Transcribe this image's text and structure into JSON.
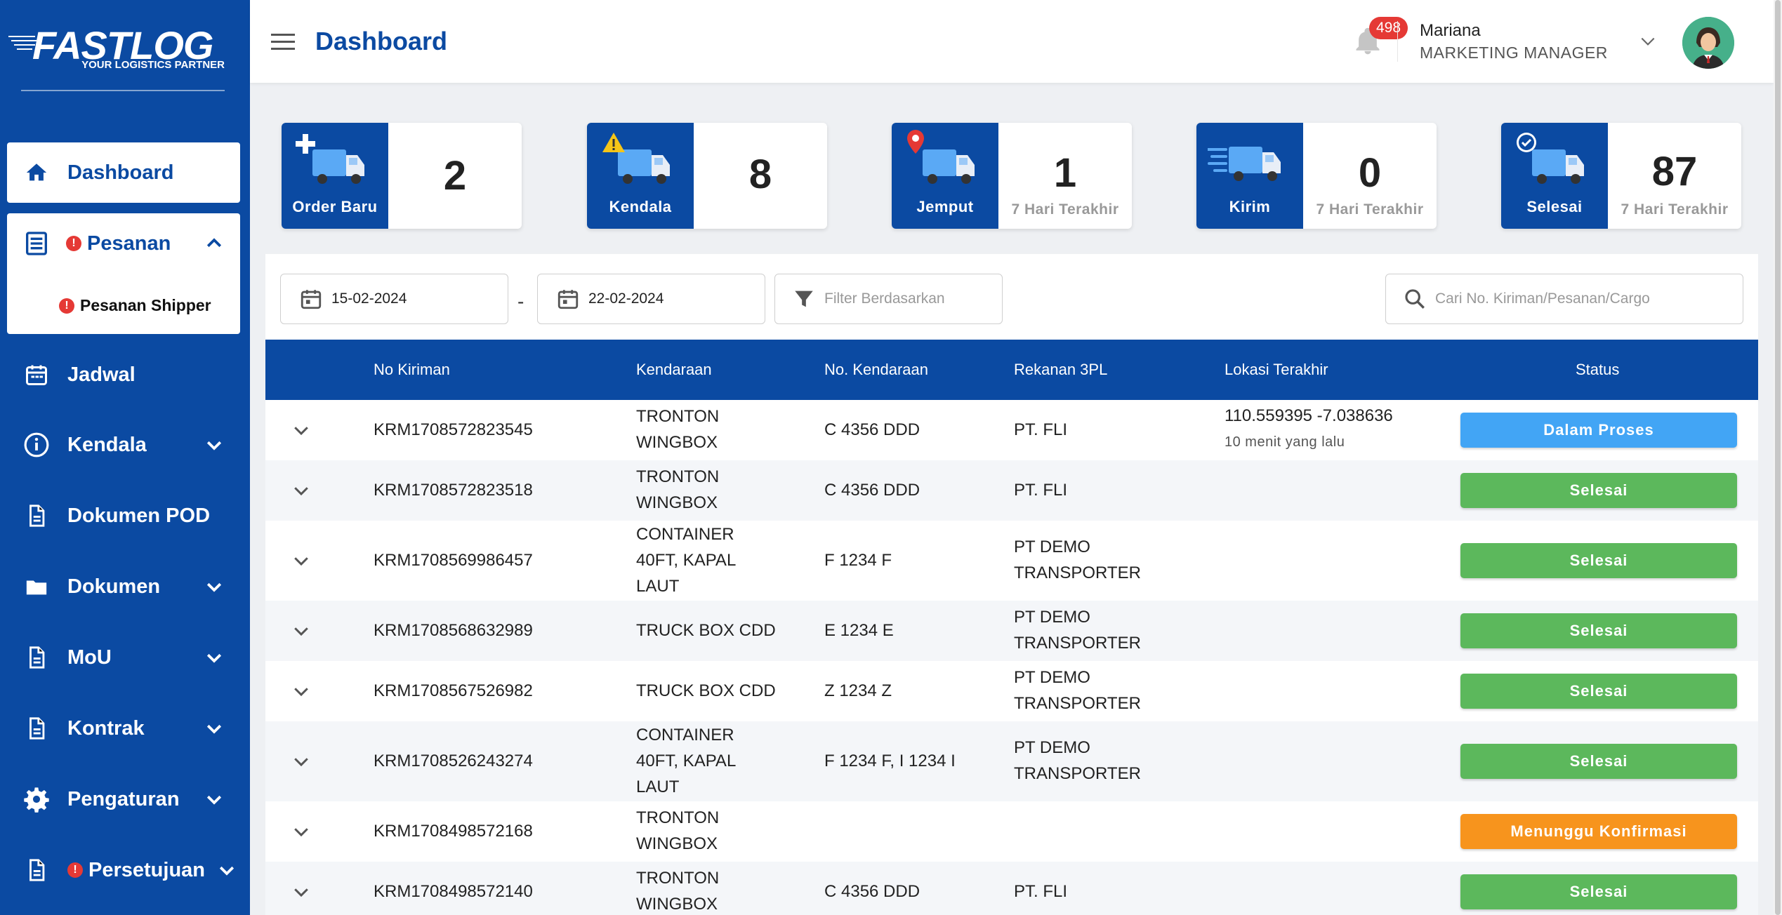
{
  "brand": {
    "name": "FASTLOG",
    "tagline": "YOUR LOGISTICS PARTNER"
  },
  "sidebar": {
    "items": [
      {
        "label": "Dashboard",
        "icon": "home-icon",
        "active": true
      },
      {
        "label": "Pesanan",
        "icon": "list-icon",
        "expanded": true,
        "alert": "!",
        "children": [
          {
            "label": "Pesanan Shipper",
            "alert": "!"
          }
        ]
      },
      {
        "label": "Jadwal",
        "icon": "calendar-icon"
      },
      {
        "label": "Kendala",
        "icon": "info-icon"
      },
      {
        "label": "Dokumen POD",
        "icon": "document-icon"
      },
      {
        "label": "Dokumen",
        "icon": "folder-icon"
      },
      {
        "label": "MoU",
        "icon": "document-icon"
      },
      {
        "label": "Kontrak",
        "icon": "document-icon"
      },
      {
        "label": "Pengaturan",
        "icon": "gear-icon"
      },
      {
        "label": "Persetujuan",
        "icon": "document-icon",
        "alert": "!"
      }
    ]
  },
  "header": {
    "title": "Dashboard",
    "notification_count": "498",
    "user_name": "Mariana",
    "user_role": "MARKETING MANAGER"
  },
  "stats": [
    {
      "label": "Order Baru",
      "value": "2",
      "note": "",
      "icon": "truck-plus-icon"
    },
    {
      "label": "Kendala",
      "value": "8",
      "note": "",
      "icon": "truck-warning-icon"
    },
    {
      "label": "Jemput",
      "value": "1",
      "note": "7 Hari Terakhir",
      "icon": "truck-pin-icon"
    },
    {
      "label": "Kirim",
      "value": "0",
      "note": "7 Hari Terakhir",
      "icon": "truck-fast-icon"
    },
    {
      "label": "Selesai",
      "value": "87",
      "note": "7 Hari Terakhir",
      "icon": "truck-check-icon"
    }
  ],
  "filters": {
    "date_from": "15-02-2024",
    "date_separator": "-",
    "date_to": "22-02-2024",
    "filter_placeholder": "Filter Berdasarkan",
    "search_placeholder": "Cari No. Kiriman/Pesanan/Cargo"
  },
  "table": {
    "columns": [
      "No Kiriman",
      "Kendaraan",
      "No. Kendaraan",
      "Rekanan 3PL",
      "Lokasi Terakhir",
      "Status"
    ],
    "rows": [
      {
        "no": "KRM1708572823545",
        "kendaraan": [
          "TRONTON",
          "WINGBOX"
        ],
        "nopol": "C 4356 DDD",
        "rekanan": [
          "PT. FLI"
        ],
        "lokasi": "110.559395 -7.038636",
        "lokasi_time": "10 menit yang lalu",
        "status": "Dalam Proses",
        "status_color": "#42a5f5"
      },
      {
        "no": "KRM1708572823518",
        "kendaraan": [
          "TRONTON",
          "WINGBOX"
        ],
        "nopol": "C 4356 DDD",
        "rekanan": [
          "PT. FLI"
        ],
        "lokasi": "",
        "lokasi_time": "",
        "status": "Selesai",
        "status_color": "#5cb85c"
      },
      {
        "no": "KRM1708569986457",
        "kendaraan": [
          "CONTAINER",
          "40FT, KAPAL",
          "LAUT"
        ],
        "nopol": "F 1234 F",
        "rekanan": [
          "PT DEMO",
          "TRANSPORTER"
        ],
        "lokasi": "",
        "lokasi_time": "",
        "status": "Selesai",
        "status_color": "#5cb85c"
      },
      {
        "no": "KRM1708568632989",
        "kendaraan": [
          "TRUCK BOX CDD"
        ],
        "nopol": "E 1234 E",
        "rekanan": [
          "PT DEMO",
          "TRANSPORTER"
        ],
        "lokasi": "",
        "lokasi_time": "",
        "status": "Selesai",
        "status_color": "#5cb85c"
      },
      {
        "no": "KRM1708567526982",
        "kendaraan": [
          "TRUCK BOX CDD"
        ],
        "nopol": "Z 1234 Z",
        "rekanan": [
          "PT DEMO",
          "TRANSPORTER"
        ],
        "lokasi": "",
        "lokasi_time": "",
        "status": "Selesai",
        "status_color": "#5cb85c"
      },
      {
        "no": "KRM1708526243274",
        "kendaraan": [
          "CONTAINER",
          "40FT, KAPAL",
          "LAUT"
        ],
        "nopol": "F 1234 F, I 1234 I",
        "rekanan": [
          "PT DEMO",
          "TRANSPORTER"
        ],
        "lokasi": "",
        "lokasi_time": "",
        "status": "Selesai",
        "status_color": "#5cb85c"
      },
      {
        "no": "KRM1708498572168",
        "kendaraan": [
          "TRONTON",
          "WINGBOX"
        ],
        "nopol": "",
        "rekanan": [],
        "lokasi": "",
        "lokasi_time": "",
        "status": "Menunggu Konfirmasi",
        "status_color": "#f7941d"
      },
      {
        "no": "KRM1708498572140",
        "kendaraan": [
          "TRONTON",
          "WINGBOX"
        ],
        "nopol": "C 4356 DDD",
        "rekanan": [
          "PT. FLI"
        ],
        "lokasi": "",
        "lokasi_time": "",
        "status": "Selesai",
        "status_color": "#5cb85c"
      }
    ]
  },
  "colors": {
    "primary": "#0b4aa2",
    "success": "#5cb85c",
    "info": "#42a5f5",
    "warning": "#f7941d",
    "alert": "#e53935"
  }
}
